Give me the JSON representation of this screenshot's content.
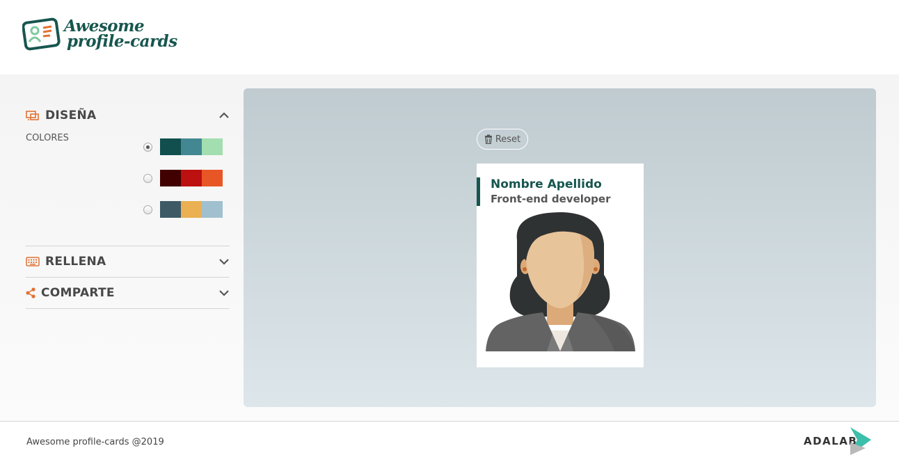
{
  "app": {
    "logo_line1": "Awesome",
    "logo_line2": "profile-cards"
  },
  "sidebar": {
    "design": {
      "title": "DISEÑA",
      "icon": "palette-screen-icon",
      "expanded": true
    },
    "colors_label": "COLORES",
    "palettes": [
      {
        "selected": true,
        "colors": [
          "#114e4e",
          "#438792",
          "#a2deaf"
        ]
      },
      {
        "selected": false,
        "colors": [
          "#420101",
          "#bd1010",
          "#e95626"
        ]
      },
      {
        "selected": false,
        "colors": [
          "#3e5b65",
          "#eab052",
          "#a0c0cf"
        ]
      }
    ],
    "fill": {
      "title": "RELLENA",
      "icon": "keyboard-icon",
      "expanded": false
    },
    "share": {
      "title": "COMPARTE",
      "icon": "share-icon",
      "expanded": false
    }
  },
  "preview": {
    "reset_label": "Reset",
    "card": {
      "name": "Nombre Apellido",
      "job": "Front-end developer"
    }
  },
  "footer": {
    "copyright": "Awesome profile-cards @2019",
    "brand": "ADALAB"
  },
  "colors": {
    "accent": "#e17334",
    "primary": "#17564f"
  }
}
